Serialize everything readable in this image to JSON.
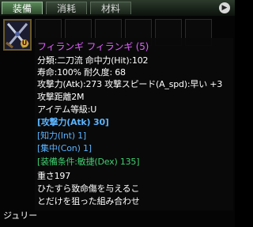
{
  "tabs": [
    {
      "label": "装備",
      "active": true
    },
    {
      "label": "消耗",
      "active": false
    },
    {
      "label": "材料",
      "active": false
    }
  ],
  "next_icon": "triangle-right-icon",
  "item": {
    "icon": "dual-swords-icon",
    "badge": "U",
    "name": "フィランギ フィランギ (5)",
    "lines": [
      {
        "text": "分類:二刀流 命中力(Hit):102",
        "color": "#ffffff"
      },
      {
        "text": "寿命:100%  耐久度: 68",
        "color": "#ffffff"
      },
      {
        "text": "攻撃力(Atk):273 攻撃スピード(A_spd):早い +3",
        "color": "#ffffff"
      },
      {
        "text": "攻撃距離2M",
        "color": "#ffffff"
      },
      {
        "text": "アイテム等級:U",
        "color": "#ffffff"
      },
      {
        "text": "[攻撃力(Atk) 30]",
        "color": "#5ab4ff",
        "bold": true
      },
      {
        "text": "[知力(Int) 1]",
        "color": "#5ab4ff"
      },
      {
        "text": "[集中(Con) 1]",
        "color": "#5ab4ff"
      },
      {
        "text": "[装備条件:敏捷(Dex) 135]",
        "color": "#40d070"
      },
      {
        "text": "重さ197",
        "color": "#ffffff"
      },
      {
        "text": "ひたすら致命傷を与えるこ",
        "color": "#ffffff"
      },
      {
        "text": "とだけを狙った組み合わせ",
        "color": "#ffffff"
      }
    ]
  },
  "character_label": "ジュリー"
}
